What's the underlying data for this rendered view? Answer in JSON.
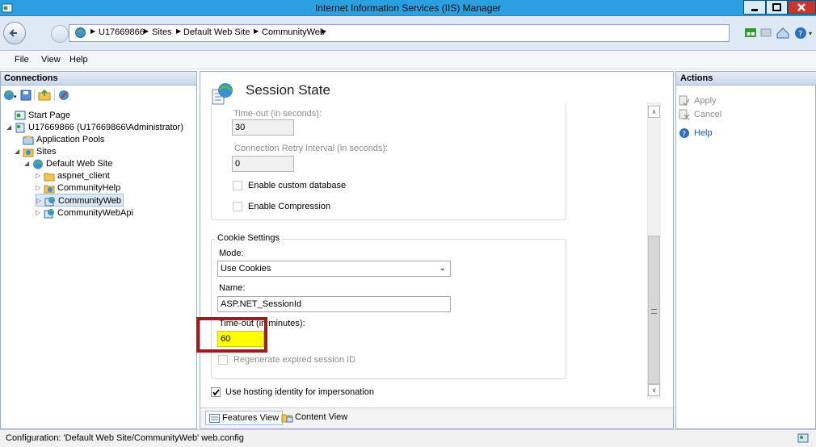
{
  "window": {
    "title": "Internet Information Services (IIS) Manager"
  },
  "address": {
    "crumbs": [
      "U17669866",
      "Sites",
      "Default Web Site",
      "CommunityWeb"
    ]
  },
  "menu": {
    "items": [
      "File",
      "View",
      "Help"
    ]
  },
  "connections": {
    "header": "Connections",
    "tree": [
      "Start Page",
      "U17669866 (U17669866\\Administrator)",
      "Application Pools",
      "Sites",
      "Default Web Site",
      "aspnet_client",
      "CommunityHelp",
      "CommunityWeb",
      "CommunityWebApi"
    ]
  },
  "main": {
    "title": "Session State",
    "timeout_seconds_label": "Time-out (in seconds):",
    "timeout_seconds_value": "30",
    "retry_label": "Connection Retry Interval (in seconds):",
    "retry_value": "0",
    "enable_custom_db": "Enable custom database",
    "enable_compression": "Enable Compression",
    "cookie": {
      "legend": "Cookie Settings",
      "mode_label": "Mode:",
      "mode_value": "Use Cookies",
      "name_label": "Name:",
      "name_value": "ASP.NET_SessionId",
      "timeout_label": "Time-out (in minutes):",
      "timeout_value": "60",
      "regenerate": "Regenerate expired session ID"
    },
    "hosting_identity": "Use hosting identity for impersonation",
    "tabs": [
      "Features View",
      "Content View"
    ]
  },
  "actions": {
    "header": "Actions",
    "items": [
      "Apply",
      "Cancel",
      "Help"
    ]
  },
  "status": {
    "text": "Configuration: 'Default Web Site/CommunityWeb' web.config"
  },
  "colors": {
    "titlebar": "#2b9fe0",
    "highlight_fill": "#ffff00",
    "annotation_border": "#9d1c1c"
  }
}
